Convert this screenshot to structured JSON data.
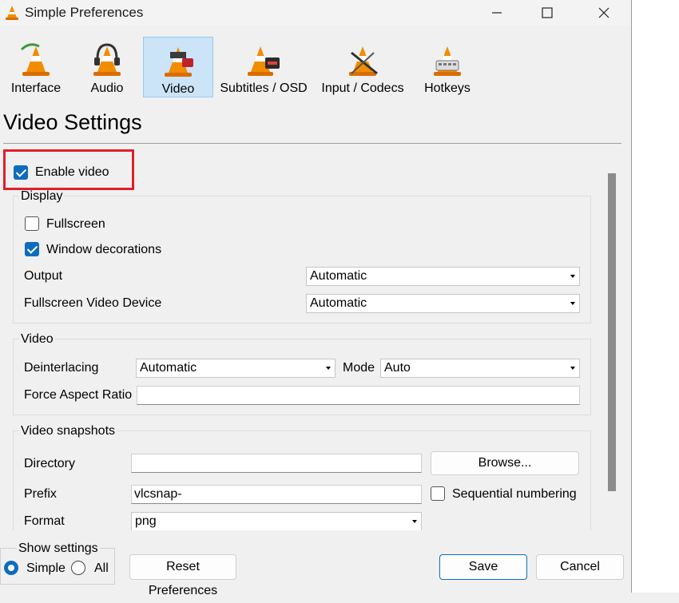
{
  "window": {
    "title": "Simple Preferences"
  },
  "categories": [
    {
      "label": "Interface",
      "selected": false
    },
    {
      "label": "Audio",
      "selected": false
    },
    {
      "label": "Video",
      "selected": true
    },
    {
      "label": "Subtitles / OSD",
      "selected": false
    },
    {
      "label": "Input / Codecs",
      "selected": false
    },
    {
      "label": "Hotkeys",
      "selected": false
    }
  ],
  "page": {
    "title": "Video Settings"
  },
  "enable_video": {
    "label": "Enable video",
    "checked": true
  },
  "display": {
    "title": "Display",
    "fullscreen": {
      "label": "Fullscreen",
      "checked": false
    },
    "window_decorations": {
      "label": "Window decorations",
      "checked": true
    },
    "output": {
      "label": "Output",
      "value": "Automatic"
    },
    "fullscreen_device": {
      "label": "Fullscreen Video Device",
      "value": "Automatic"
    }
  },
  "video": {
    "title": "Video",
    "deinterlacing": {
      "label": "Deinterlacing",
      "value": "Automatic"
    },
    "mode": {
      "label": "Mode",
      "value": "Auto"
    },
    "aspect_ratio": {
      "label": "Force Aspect Ratio",
      "value": ""
    }
  },
  "snapshots": {
    "title": "Video snapshots",
    "directory": {
      "label": "Directory",
      "value": ""
    },
    "browse_label": "Browse...",
    "prefix": {
      "label": "Prefix",
      "value": "vlcsnap-"
    },
    "sequential": {
      "label": "Sequential numbering",
      "checked": false
    },
    "format": {
      "label": "Format",
      "value": "png"
    }
  },
  "show_settings": {
    "title": "Show settings",
    "simple_label": "Simple",
    "all_label": "All",
    "selected": "Simple"
  },
  "buttons": {
    "reset": "Reset Preferences",
    "save": "Save",
    "cancel": "Cancel"
  },
  "colors": {
    "accent": "#0f6cbd",
    "highlight": "#e0202a",
    "selected_tab": "#cce4f7"
  }
}
